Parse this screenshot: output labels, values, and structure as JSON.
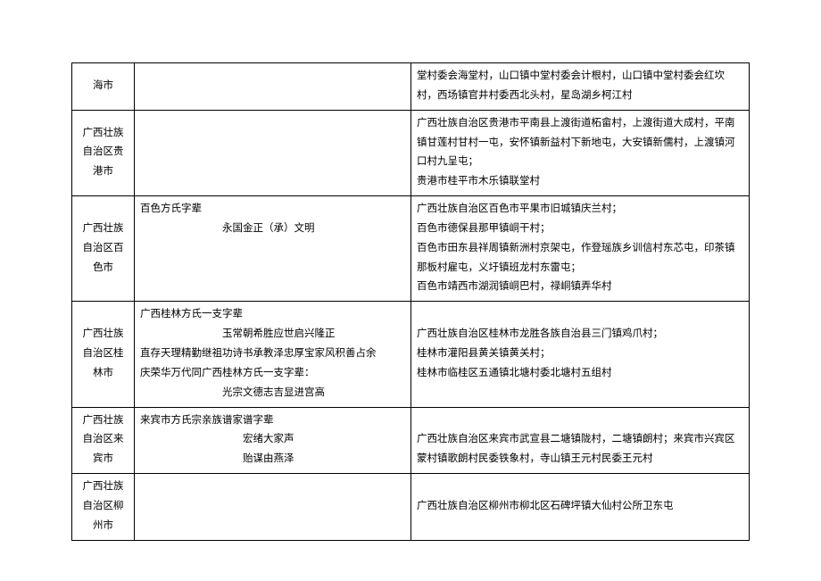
{
  "rows": [
    {
      "region": "海市",
      "poem": "",
      "locations": "堂村委会海堂村，山口镇中堂村委会计根村，山口镇中堂村委会红坎村，西场镇官井村委西北头村，星岛湖乡柯江村"
    },
    {
      "region": "广西壮族自治区贵港市",
      "poem": "",
      "locations": "广西壮族自治区贵港市平南县上渡街道柘畲村，上渡街道大成村，平南镇甘莲村甘村一屯，安怀镇新益村下新地屯，大安镇新儒村，上渡镇河口村九呈屯；\n贵港市桂平市木乐镇联堂村"
    },
    {
      "region": "广西壮族自治区百色市",
      "poem_title": "百色方氏字辈",
      "poem_line1": "永国金正（承）文明",
      "locations": "广西壮族自治区百色市平果市旧城镇庆兰村；\n百色市德保县那甲镇峒干村；\n百色市田东县祥周镇新洲村京架屯，作登瑶族乡训信村东芯屯，印茶镇那板村雇屯，义圩镇班龙村东雷屯；\n百色市靖西市湖润镇峒巴村，禄峒镇弄华村"
    },
    {
      "region": "广西壮族自治区桂林市",
      "poem_title": "广西桂林方氏一支字辈",
      "poem_line1": "玉常朝希胜应世启兴隆正",
      "poem_line2": "直存天理精勤继祖功诗书承教泽忠厚宝家风积善占余",
      "poem_line3": "庆荣华万代同广西桂林方氏一支字辈：",
      "poem_line4": "光宗文德志吉显进宫高",
      "locations": "广西壮族自治区桂林市龙胜各族自治县三门镇鸡爪村；\n桂林市灌阳县黄关镇黄关村；\n桂林市临桂区五通镇北塘村委北塘村五组村"
    },
    {
      "region": "广西壮族自治区来宾市",
      "poem_title": "来宾市方氏宗亲族谱家谱字辈",
      "poem_line1": "宏绪大家声",
      "poem_line2a": "贻谋由燕泽",
      "locations": "广西壮族自治区来宾市武宣县二塘镇陇村，二塘镇朗村；来宾市兴宾区蒙村镇歌朗村民委铁象村，寺山镇王元村民委王元村"
    },
    {
      "region": "广西壮族自治区柳州市",
      "poem": "",
      "locations": "广西壮族自治区柳州市柳北区石碑坪镇大仙村公所卫东屯"
    }
  ]
}
